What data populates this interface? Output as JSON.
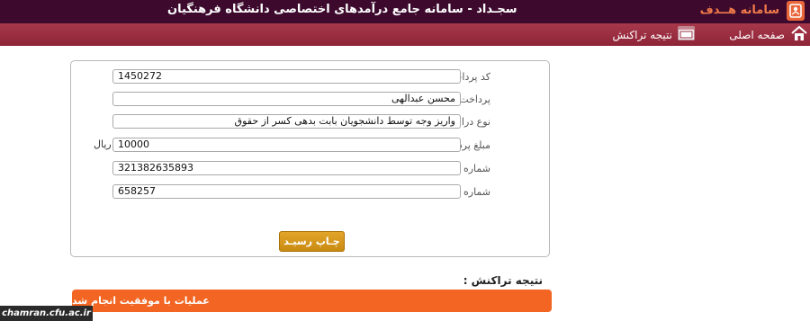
{
  "header": {
    "logo_text": "سامانه هــدف",
    "title": "سجـداد - سامانه جامع درآمدهای اختصاصی دانشگاه فرهنگیان"
  },
  "nav": {
    "home": {
      "label": "صفحه اصلی",
      "icon": "home-icon"
    },
    "transaction": {
      "label": "نتیجه تراکنش",
      "icon": "window-icon"
    }
  },
  "form": {
    "fields": [
      {
        "label": "کد پرداخت :",
        "value": "1450272"
      },
      {
        "label": "پرداخت کننده :",
        "value": "محسن عبدالهی"
      },
      {
        "label": "نوع درامد :",
        "value": "واریز وجه توسط دانشجویان بابت بدهی کسر از حقوق"
      },
      {
        "label": "مبلغ پرداخت :",
        "value": "10000",
        "unit": "ریال"
      },
      {
        "label": "شماره مرجع :",
        "value": "321382635893"
      },
      {
        "label": "شماره پیگیری :",
        "value": "658257"
      }
    ],
    "print_button": "چـاپ رسیـد"
  },
  "result": {
    "title": "نتیجه تراکنش :",
    "message": "عملیات با موفقیت انجام شد"
  },
  "watermark": "chamran.cfu.ac.ir",
  "colors": {
    "topbar": "#3d0a2e",
    "navbar": "#9a2b40",
    "accent_orange": "#f26522",
    "button_gold": "#d9991c"
  }
}
